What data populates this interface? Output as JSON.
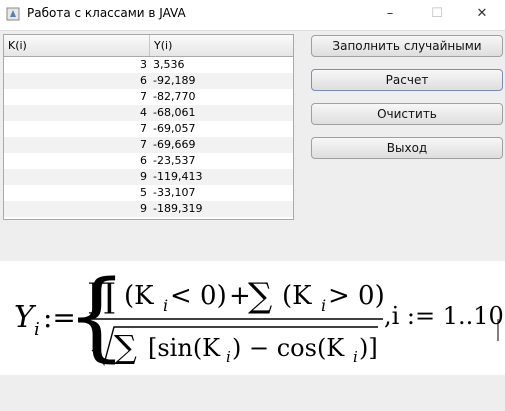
{
  "window": {
    "title": "Работа с классами в JAVA",
    "minimize": "–",
    "maximize": "☐",
    "close": "✕"
  },
  "table": {
    "headers": [
      "K(i)",
      "Y(i)"
    ],
    "rows": [
      {
        "k": "3",
        "y": "3,536"
      },
      {
        "k": "6",
        "y": "-92,189"
      },
      {
        "k": "7",
        "y": "-82,770"
      },
      {
        "k": "4",
        "y": "-68,061"
      },
      {
        "k": "7",
        "y": "-69,057"
      },
      {
        "k": "7",
        "y": "-69,669"
      },
      {
        "k": "6",
        "y": "-23,537"
      },
      {
        "k": "9",
        "y": "-119,413"
      },
      {
        "k": "5",
        "y": "-33,107"
      },
      {
        "k": "9",
        "y": "-189,319"
      }
    ]
  },
  "buttons": {
    "fill": "Заполнить случайными",
    "calc": "Расчет",
    "clear": "Очистить",
    "exit": "Выход"
  },
  "formula": {
    "lhs": "Y",
    "lhs_sub": "i",
    "assign": ":=",
    "prod": "∏",
    "sum": "∑",
    "num_left": "(K",
    "num_sub": "i",
    "num_lt": " < 0)",
    "plus": "+",
    "num_gt": " > 0)",
    "den": "[sin(K",
    "den_mid": ") − cos(K",
    "den_end": ")]",
    "range": ",i := 1..10"
  }
}
